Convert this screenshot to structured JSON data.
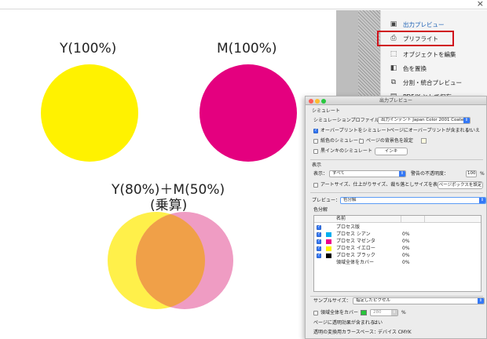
{
  "document": {
    "label_y": "Y(100%)",
    "label_m": "M(100%)",
    "label_mix_line1": "Y(80%)＋M(50%)",
    "label_mix_line2": "(乗算)"
  },
  "tools": {
    "items": [
      {
        "label": "出力プレビュー",
        "icon": "output-preview-icon"
      },
      {
        "label": "プリフライト",
        "icon": "preflight-icon"
      },
      {
        "label": "オブジェクトを編集",
        "icon": "edit-object-icon"
      },
      {
        "label": "色を置換",
        "icon": "replace-color-icon"
      },
      {
        "label": "分割・統合プレビュー",
        "icon": "flatten-preview-icon"
      },
      {
        "label": "PDF/X として保存",
        "icon": "save-pdfx-icon"
      }
    ],
    "highlight_color": "#d0121b"
  },
  "dialog": {
    "title": "出力プレビュー",
    "simulate_section": "シミュレート",
    "profile_label": "シミュレーションプロファイル：",
    "profile_value": "出力インテント Japan Color 2001 Coated",
    "overprint_label": "オーバープリントをシミュレート",
    "overprint_page_label": "ページにオーバープリントが含まれる：",
    "overprint_page_value": "いいえ",
    "paper_color_label": "紙色のシミュレート",
    "page_bg_label": "ページの背景色を設定",
    "black_ink_label": "黒インキのシミュレート",
    "ink_button": "インキ",
    "display_section": "表示",
    "show_label": "表示：",
    "show_value": "すべて",
    "opacity_warning_label": "警告の不透明度：",
    "opacity_value": "100",
    "opacity_unit": "%",
    "artbox_label": "アートサイズ、仕上がりサイズ、裁ち落としサイズを表示",
    "pagebox_button": "ページボックスを設定",
    "preview_label": "プレビュー：",
    "preview_value": "色分解",
    "separation_section": "色分解",
    "col_name": "名前",
    "separations": [
      {
        "name": "プロセス版",
        "percent": "",
        "checked": true,
        "swatch": ""
      },
      {
        "name": "プロセス シアン",
        "percent": "0%",
        "checked": true,
        "swatch": "#00aeef"
      },
      {
        "name": "プロセス マゼンタ",
        "percent": "0%",
        "checked": true,
        "swatch": "#ec008c"
      },
      {
        "name": "プロセス イエロー",
        "percent": "0%",
        "checked": true,
        "swatch": "#fff200"
      },
      {
        "name": "プロセス ブラック",
        "percent": "0%",
        "checked": true,
        "swatch": "#000000"
      },
      {
        "name": "領域全体をカバー",
        "percent": "0%",
        "checked": false,
        "swatch": ""
      }
    ],
    "sample_size_label": "サンプルサイズ：",
    "sample_size_value": "指定したピクセル",
    "coverage_label": "領域全体をカバー",
    "coverage_value": "280",
    "coverage_unit": "%",
    "transparency_label": "ページに透明効果が含まれる：",
    "transparency_value": "はい",
    "blend_space_label": "透明の変換用カラースペース：",
    "blend_space_value": "デバイス CMYK"
  },
  "colors": {
    "yellow": "#fff200",
    "magenta": "#e4007f",
    "mix_yellow": "#fff04a",
    "mix_magenta": "#ef9cc3",
    "mix_overlap": "#f0a048"
  }
}
